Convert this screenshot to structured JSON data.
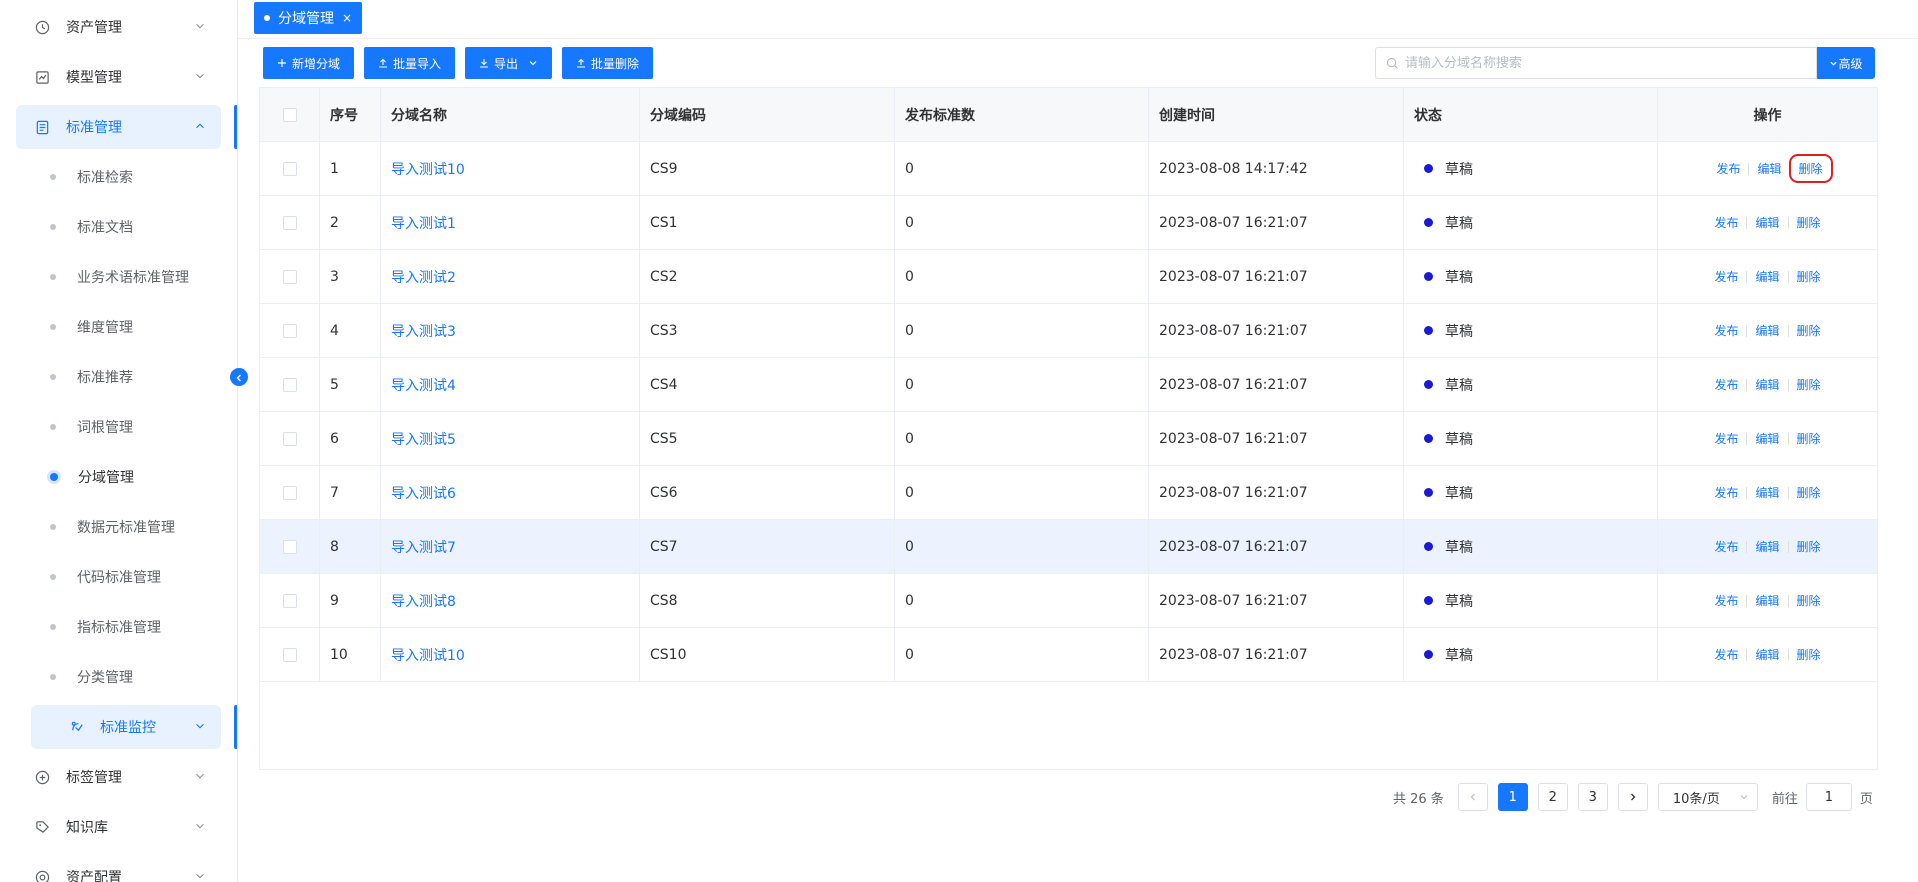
{
  "sidebar": {
    "groups": [
      {
        "label": "资产管理",
        "icon": "clock-icon"
      },
      {
        "label": "模型管理",
        "icon": "chart-icon"
      },
      {
        "label": "标准管理",
        "icon": "document-icon"
      }
    ],
    "sub_items": [
      {
        "label": "标准检索"
      },
      {
        "label": "标准文档"
      },
      {
        "label": "业务术语标准管理"
      },
      {
        "label": "维度管理"
      },
      {
        "label": "标准推荐"
      },
      {
        "label": "词根管理"
      },
      {
        "label": "分域管理"
      },
      {
        "label": "数据元标准管理"
      },
      {
        "label": "代码标准管理"
      },
      {
        "label": "指标标准管理"
      },
      {
        "label": "分类管理"
      }
    ],
    "sub_group": {
      "label": "标准监控",
      "icon": "monitor-icon"
    },
    "lower_groups": [
      {
        "label": "标签管理",
        "icon": "plus-circle-icon"
      },
      {
        "label": "知识库",
        "icon": "tag-icon"
      },
      {
        "label": "资产配置",
        "icon": "target-icon"
      }
    ]
  },
  "tab": {
    "label": "分域管理",
    "close": "×"
  },
  "toolbar": {
    "add": "新增分域",
    "import": "批量导入",
    "export": "导出",
    "batch_delete": "批量删除"
  },
  "search": {
    "placeholder": "请输入分域名称搜索",
    "advanced": "高级"
  },
  "table": {
    "columns": [
      "序号",
      "分域名称",
      "分域编码",
      "发布标准数",
      "创建时间",
      "状态",
      "操作"
    ],
    "rows": [
      {
        "idx": "1",
        "name": "导入测试10",
        "code": "CS9",
        "count": "0",
        "time": "2023-08-08 14:17:42",
        "status": "草稿"
      },
      {
        "idx": "2",
        "name": "导入测试1",
        "code": "CS1",
        "count": "0",
        "time": "2023-08-07 16:21:07",
        "status": "草稿"
      },
      {
        "idx": "3",
        "name": "导入测试2",
        "code": "CS2",
        "count": "0",
        "time": "2023-08-07 16:21:07",
        "status": "草稿"
      },
      {
        "idx": "4",
        "name": "导入测试3",
        "code": "CS3",
        "count": "0",
        "time": "2023-08-07 16:21:07",
        "status": "草稿"
      },
      {
        "idx": "5",
        "name": "导入测试4",
        "code": "CS4",
        "count": "0",
        "time": "2023-08-07 16:21:07",
        "status": "草稿"
      },
      {
        "idx": "6",
        "name": "导入测试5",
        "code": "CS5",
        "count": "0",
        "time": "2023-08-07 16:21:07",
        "status": "草稿"
      },
      {
        "idx": "7",
        "name": "导入测试6",
        "code": "CS6",
        "count": "0",
        "time": "2023-08-07 16:21:07",
        "status": "草稿"
      },
      {
        "idx": "8",
        "name": "导入测试7",
        "code": "CS7",
        "count": "0",
        "time": "2023-08-07 16:21:07",
        "status": "草稿"
      },
      {
        "idx": "9",
        "name": "导入测试8",
        "code": "CS8",
        "count": "0",
        "time": "2023-08-07 16:21:07",
        "status": "草稿"
      },
      {
        "idx": "10",
        "name": "导入测试10",
        "code": "CS10",
        "count": "0",
        "time": "2023-08-07 16:21:07",
        "status": "草稿"
      }
    ],
    "actions": {
      "publish": "发布",
      "edit": "编辑",
      "delete": "删除"
    },
    "status_color": "#1a1ad6"
  },
  "pager": {
    "total": "共 26 条",
    "pages": [
      "1",
      "2",
      "3"
    ],
    "current": "1",
    "page_size": "10条/页",
    "goto_label": "前往",
    "goto_value": "1",
    "page_unit": "页"
  },
  "colors": {
    "accent": "#1677ff",
    "highlight_box": "#e02020"
  }
}
